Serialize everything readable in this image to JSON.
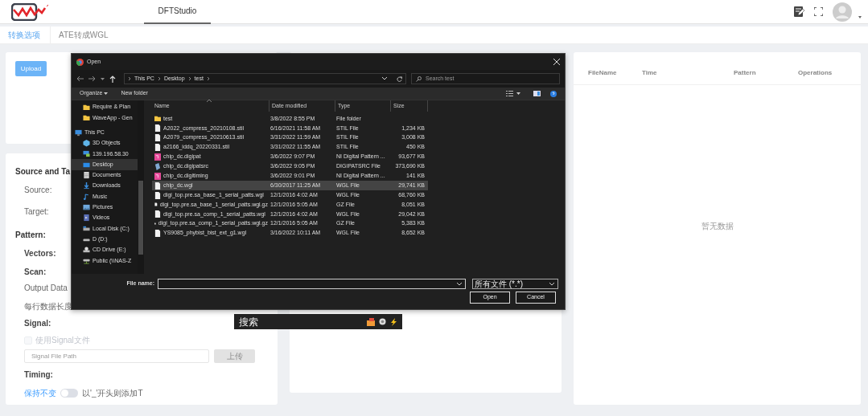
{
  "header": {
    "tabs": [
      {
        "label": "DFTStudio",
        "selected": true
      }
    ]
  },
  "subtabs": [
    {
      "label": "转换选项",
      "selected": true
    },
    {
      "label": "ATE转成WGL",
      "selected": false
    }
  ],
  "upload_button": "Upload",
  "form": {
    "title": "Source and Ta",
    "source_label": "Source:",
    "target_label": "Target:",
    "pattern_heading": "Pattern:",
    "vectors_label": "Vectors:",
    "scan_label": "Scan:",
    "output_label": "Output Data",
    "row_length_label": "每行数据长度",
    "signal_heading": "Signal:",
    "signal_checkbox": {
      "label": "使用Signal文件",
      "checked": false,
      "disabled": true
    },
    "signal_path": {
      "placeholder": "Signal File Path"
    },
    "signal_upload": {
      "label": "上传",
      "disabled": true
    },
    "timing_heading": "Timing:",
    "timing_switch": {
      "off_label": "保持不变",
      "on_label": "以'_'开头则添加T",
      "on": false
    }
  },
  "table": {
    "columns": [
      "FileName",
      "Time",
      "Pattern",
      "Operations"
    ],
    "empty_text": "暂无数据"
  },
  "dialog": {
    "title": "Open",
    "breadcrumb": [
      "This PC",
      "Desktop",
      "test"
    ],
    "search": {
      "placeholder": "Search test"
    },
    "toolbar": [
      "Organize",
      "New folder"
    ],
    "quick_access": [
      {
        "label": "Require & Plan",
        "kind": "folder",
        "selected": false
      },
      {
        "label": "WaveApp - Gen",
        "kind": "folder",
        "selected": false
      }
    ],
    "this_pc": {
      "label": "This PC",
      "kind": "pc",
      "selected": false,
      "children": [
        {
          "label": "3D Objects",
          "kind": "cube",
          "selected": false
        },
        {
          "label": "139.196.58.30",
          "kind": "network",
          "selected": false
        },
        {
          "label": "Desktop",
          "kind": "desktop",
          "selected": true
        },
        {
          "label": "Documents",
          "kind": "document",
          "selected": false
        },
        {
          "label": "Downloads",
          "kind": "download",
          "selected": false
        },
        {
          "label": "Music",
          "kind": "music",
          "selected": false
        },
        {
          "label": "Pictures",
          "kind": "picture",
          "selected": false
        },
        {
          "label": "Videos",
          "kind": "video",
          "selected": false
        },
        {
          "label": "Local Disk (C:)",
          "kind": "disk",
          "selected": false
        },
        {
          "label": "D (D:)",
          "kind": "drive",
          "selected": false
        },
        {
          "label": "CD Drive (E:)",
          "kind": "cd",
          "selected": false
        },
        {
          "label": "Public (\\\\NAS-Z",
          "kind": "netdrive",
          "selected": false
        }
      ]
    },
    "columns": [
      "Name",
      "Date modified",
      "Type",
      "Size"
    ],
    "files": [
      {
        "name": "test",
        "date": "3/8/2022 8:55 PM",
        "type": "File folder",
        "kind": "folder",
        "selected": false
      },
      {
        "name": "A2022_compress_20210108.stil",
        "date": "6/16/2021 11:58 AM",
        "type": "STIL File",
        "size": "1,234 KB",
        "kind": "file",
        "selected": false
      },
      {
        "name": "A2079_compress_20210613.stil",
        "date": "3/31/2022 11:59 AM",
        "type": "STIL File",
        "size": "3,008 KB",
        "kind": "file",
        "selected": false
      },
      {
        "name": "a2166_iddq_20220331.stil",
        "date": "3/31/2022 11:55 AM",
        "type": "STIL File",
        "size": "450 KB",
        "kind": "file",
        "selected": false
      },
      {
        "name": "chip_dc.digipat",
        "date": "3/6/2022 9:07 PM",
        "type": "NI Digital Pattern ...",
        "size": "93,677 KB",
        "kind": "pattern",
        "selected": false
      },
      {
        "name": "chip_dc.digipatsrc",
        "date": "3/6/2022 9:05 PM",
        "type": "DIGIPATSRC File",
        "size": "373,690 KB",
        "kind": "source",
        "selected": false
      },
      {
        "name": "chip_dc.digitiming",
        "date": "3/6/2022 9:01 PM",
        "type": "NI Digital Pattern ...",
        "size": "141 KB",
        "kind": "pattern",
        "selected": false
      },
      {
        "name": "chip_dc.wgl",
        "date": "6/30/2017 11:25 AM",
        "type": "WGL File",
        "size": "29,741 KB",
        "kind": "file",
        "selected": true
      },
      {
        "name": "digi_top.pre.sa_base_1_serial_patts.wgl",
        "date": "12/1/2016 4:02 AM",
        "type": "WGL File",
        "size": "68,760 KB",
        "kind": "file",
        "selected": false
      },
      {
        "name": "digi_top.pre.sa_base_1_serial_patts.wgl.gz",
        "date": "12/1/2016 5:05 AM",
        "type": "GZ File",
        "size": "8,051 KB",
        "kind": "file",
        "selected": false
      },
      {
        "name": "digi_top.pre.sa_comp_1_serial_patts.wgl",
        "date": "12/1/2016 4:02 AM",
        "type": "WGL File",
        "size": "29,042 KB",
        "kind": "file",
        "selected": false
      },
      {
        "name": "digi_top.pre.sa_comp_1_serial_patts.wgl.gz",
        "date": "12/1/2016 5:05 AM",
        "type": "GZ File",
        "size": "5,383 KB",
        "kind": "file",
        "selected": false
      },
      {
        "name": "YS9085_phybist_bist_ext_g1.wgl",
        "date": "3/16/2022 10:11 AM",
        "type": "WGL File",
        "size": "8,652 KB",
        "kind": "file",
        "selected": false
      }
    ],
    "file_name_label": "File name:",
    "filter": "所有文件 (*.*)",
    "buttons": [
      "Open",
      "Cancel"
    ]
  },
  "search_bar": {
    "label": "搜索"
  }
}
